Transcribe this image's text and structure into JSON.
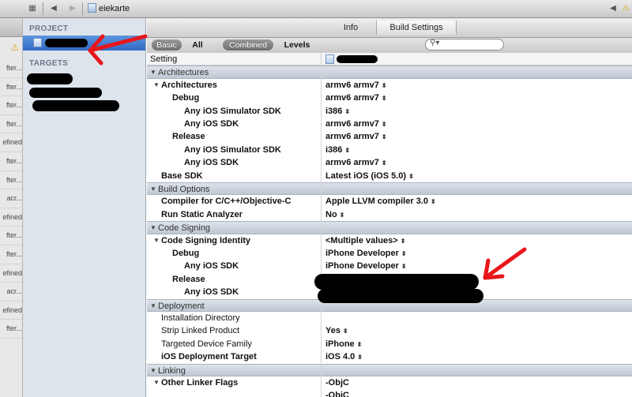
{
  "jumpbar": {
    "breadcrumb": "eiekarte",
    "back_glyph": "◀",
    "fwd_glyph": "▶",
    "warn_glyph": "⚠"
  },
  "issues": {
    "items": [
      "fter...",
      "fter...",
      "fter...",
      "fter...",
      "efined",
      "fter...",
      "fter...",
      "acr...",
      "efined",
      "fter...",
      "fter...",
      "efined",
      "acr...",
      "efined",
      "fter..."
    ]
  },
  "navigator": {
    "project_header": "PROJECT",
    "targets_header": "TARGETS"
  },
  "tabs": {
    "info": "Info",
    "build_settings": "Build Settings"
  },
  "filters": {
    "basic": "Basic",
    "all": "All",
    "combined": "Combined",
    "levels": "Levels"
  },
  "table": {
    "header_setting": "Setting",
    "rows": [
      {
        "kind": "section",
        "label": "Architectures"
      },
      {
        "kind": "row",
        "level": 0,
        "disclosure": true,
        "bold": true,
        "label": "Architectures",
        "value": "armv6 armv7",
        "stepper": true
      },
      {
        "kind": "row",
        "level": 1,
        "label": "Debug",
        "value": "armv6 armv7",
        "stepper": true
      },
      {
        "kind": "row",
        "level": 2,
        "label": "Any iOS Simulator SDK",
        "value": "i386",
        "stepper": true
      },
      {
        "kind": "row",
        "level": 2,
        "label": "Any iOS SDK",
        "value": "armv6 armv7",
        "stepper": true
      },
      {
        "kind": "row",
        "level": 1,
        "label": "Release",
        "value": "armv6 armv7",
        "stepper": true
      },
      {
        "kind": "row",
        "level": 2,
        "label": "Any iOS Simulator SDK",
        "value": "i386",
        "stepper": true
      },
      {
        "kind": "row",
        "level": 2,
        "label": "Any iOS SDK",
        "value": "armv6 armv7",
        "stepper": true
      },
      {
        "kind": "row",
        "level": 0,
        "bold": true,
        "label": "Base SDK",
        "value": "Latest iOS (iOS 5.0)",
        "stepper": true
      },
      {
        "kind": "section",
        "label": "Build Options"
      },
      {
        "kind": "row",
        "level": 0,
        "bold": true,
        "label": "Compiler for C/C++/Objective-C",
        "value": "Apple LLVM compiler 3.0",
        "stepper": true
      },
      {
        "kind": "row",
        "level": 0,
        "bold": true,
        "label": "Run Static Analyzer",
        "value": "No",
        "stepper": true
      },
      {
        "kind": "section",
        "label": "Code Signing"
      },
      {
        "kind": "row",
        "level": 0,
        "disclosure": true,
        "bold": true,
        "label": "Code Signing Identity",
        "value": "<Multiple values>",
        "stepper": true
      },
      {
        "kind": "row",
        "level": 1,
        "label": "Debug",
        "value": "iPhone Developer",
        "stepper": true
      },
      {
        "kind": "row",
        "level": 2,
        "label": "Any iOS SDK",
        "value": "iPhone Developer",
        "stepper": true
      },
      {
        "kind": "row",
        "level": 1,
        "label": "Release",
        "value": "",
        "stepper": false
      },
      {
        "kind": "row",
        "level": 2,
        "label": "Any iOS SDK",
        "value": "",
        "stepper": false
      },
      {
        "kind": "section",
        "label": "Deployment"
      },
      {
        "kind": "row",
        "level": 0,
        "label": "Installation Directory",
        "value": "",
        "stepper": false
      },
      {
        "kind": "row",
        "level": 0,
        "label": "Strip Linked Product",
        "value": "Yes",
        "stepper": true
      },
      {
        "kind": "row",
        "level": 0,
        "label": "Targeted Device Family",
        "value": "iPhone",
        "stepper": true
      },
      {
        "kind": "row",
        "level": 0,
        "bold": true,
        "label": "iOS Deployment Target",
        "value": "iOS 4.0",
        "stepper": true
      },
      {
        "kind": "section",
        "label": "Linking"
      },
      {
        "kind": "row",
        "level": 0,
        "disclosure": true,
        "bold": true,
        "label": "Other Linker Flags",
        "value": "-ObjC",
        "stepper": false
      },
      {
        "kind": "row",
        "level": 1,
        "label": "",
        "value": "-ObjC",
        "stepper": false
      }
    ]
  },
  "colors": {
    "annotation_red": "#e8161b",
    "selection_blue": "#3d7bd3"
  }
}
